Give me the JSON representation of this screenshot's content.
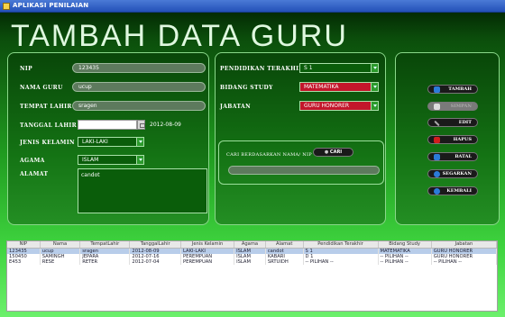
{
  "window": {
    "title": "APLIKASI PENILAIAN"
  },
  "heading": "TAMBAH DATA GURU",
  "form_left": {
    "nip": {
      "label": "NIP",
      "value": "123435"
    },
    "nama": {
      "label": "NAMA GURU",
      "value": "ucup"
    },
    "tempat": {
      "label": "TEMPAT LAHIR",
      "value": "sragen"
    },
    "tanggal": {
      "label": "TANGGAL LAHIR",
      "value": "",
      "display": "2012-08-09"
    },
    "jk": {
      "label": "JENIS KELAMIN",
      "value": "LAKI-LAKI"
    },
    "agama": {
      "label": "AGAMA",
      "value": "ISLAM"
    },
    "alamat": {
      "label": "ALAMAT",
      "value": "candot"
    }
  },
  "form_right": {
    "pendidikan": {
      "label": "PENDIDIKAN TERAKHIR",
      "value": "S 1"
    },
    "bidang": {
      "label": "BIDANG STUDY",
      "value": "MATEMATIKA"
    },
    "jabatan": {
      "label": "JABATAN",
      "value": "GURU HONORER"
    }
  },
  "search": {
    "label": "CARI BERDASARKAN NAMA/ NIP",
    "button": "CARI",
    "value": ""
  },
  "actions": {
    "tambah": "TAMBAH",
    "simpan": "SIMPAN",
    "edit": "EDIT",
    "hapus": "HAPUS",
    "batal": "BATAL",
    "segarkan": "SEGARKAN",
    "kembali": "KEMBALI"
  },
  "table": {
    "headers": [
      "NIP",
      "Nama",
      "TempatLahir",
      "TanggalLahir",
      "Jenis Kelamin",
      "Agama",
      "Alamat",
      "Pendidikan Terakhir",
      "Bidang Study",
      "Jabatan"
    ],
    "rows": [
      [
        "123435",
        "ucup",
        "sragen",
        "2012-08-09",
        "LAKI-LAKI",
        "ISLAM",
        "candot",
        "S 1",
        "MATEMATIKA",
        "GURU HONORER"
      ],
      [
        "150450",
        "SAMINGH",
        "JEPARA",
        "2012-07-16",
        "PEREMPUAN",
        "ISLAM",
        "KABARI",
        "D 1",
        "-- PILIHAN --",
        "GURU HONORER"
      ],
      [
        "E453",
        "RESE",
        "RETER",
        "2012-07-04",
        "PEREMPUAN",
        "ISLAM",
        "SRTUIDH",
        "-- PILIHAN --",
        "-- PILIHAN --",
        "-- PILIHAN --"
      ]
    ]
  },
  "colors": {
    "accent": "#1f9a1f",
    "hapus_icon": "#d21d1d",
    "tambah_icon": "#2b7bd8"
  }
}
